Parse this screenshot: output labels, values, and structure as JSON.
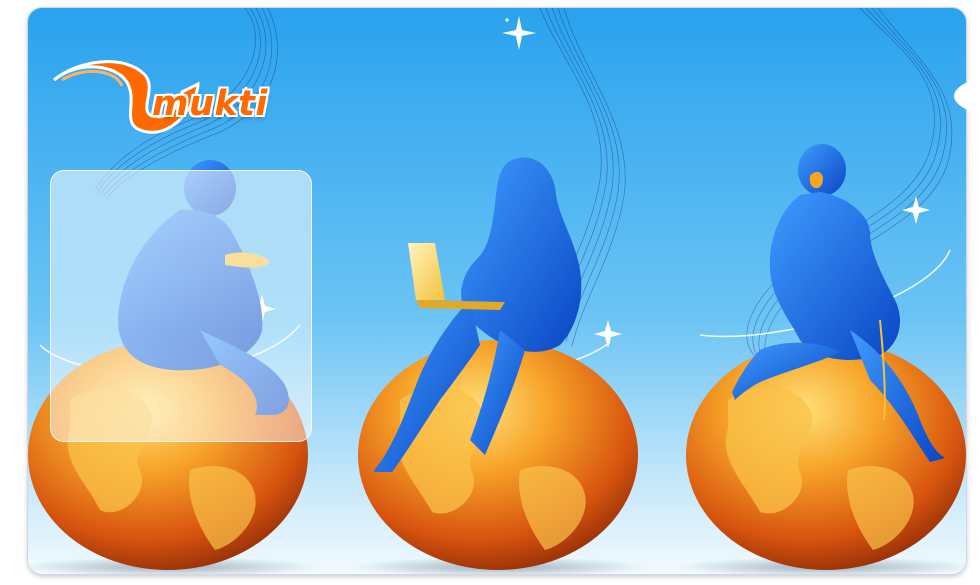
{
  "logo": {
    "text": "mukti",
    "icon": "vmukti-swoosh-logo-icon"
  },
  "colors": {
    "sky_top": "#29a4f0",
    "sky_bottom": "#e9f6fd",
    "globe_orange": "#f08a18",
    "globe_dark": "#c0440e",
    "figure_blue": "#1f6fe0",
    "logo_orange": "#ff6a00"
  },
  "scene": {
    "figures": [
      "person-reading-on-globe",
      "woman-with-laptop-on-globe",
      "woman-on-phone-on-globe"
    ]
  }
}
